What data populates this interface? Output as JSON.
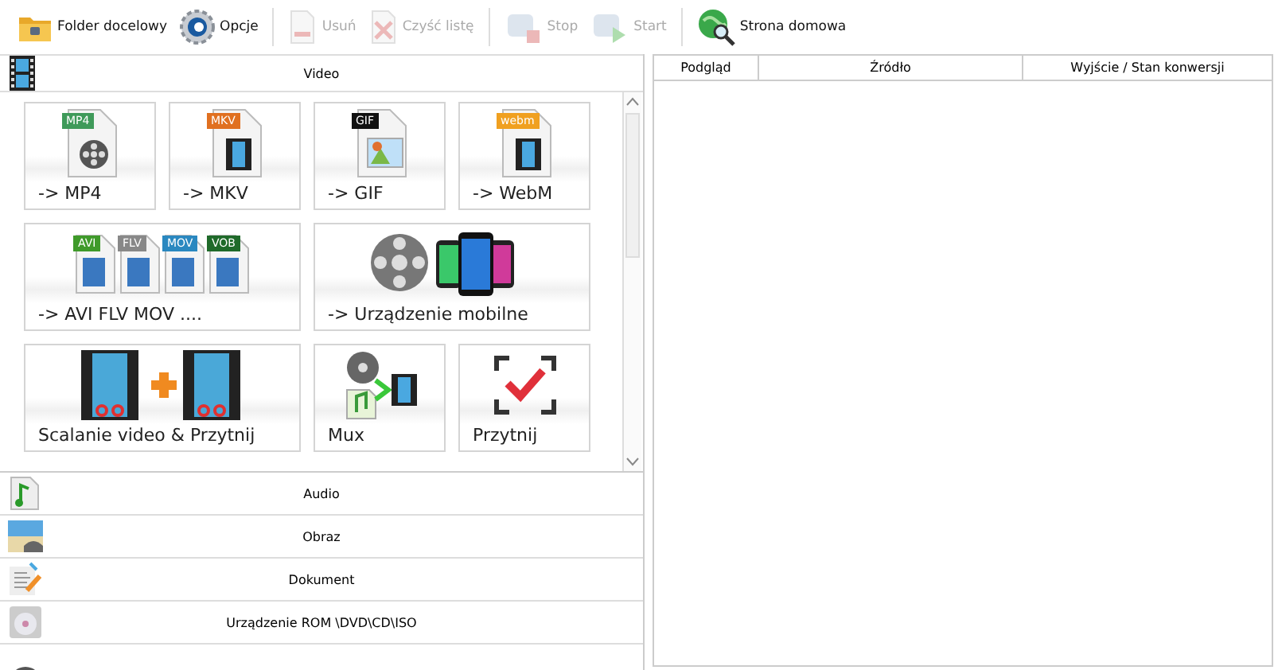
{
  "toolbar": [
    [
      {
        "label": "Folder docelowy",
        "disabled": false
      },
      {
        "label": "Opcje",
        "disabled": false
      }
    ],
    [
      {
        "label": "Usuń",
        "disabled": true
      },
      {
        "label": "Czyść listę",
        "disabled": true
      }
    ],
    [
      {
        "label": "Stop",
        "disabled": true
      },
      {
        "label": "Start",
        "disabled": true
      }
    ],
    [
      {
        "label": "Strona domowa",
        "disabled": false
      }
    ]
  ],
  "video_section": {
    "title": "Video",
    "expanded": true
  },
  "tiles": [
    {
      "label": "-> MP4",
      "badges": [
        "MP4"
      ]
    },
    {
      "label": "-> MKV",
      "badges": [
        "MKV"
      ]
    },
    {
      "label": "-> GIF",
      "badges": [
        "GIF"
      ]
    },
    {
      "label": "-> WebM",
      "badges": [
        "webm"
      ]
    },
    {
      "label": "-> AVI FLV MOV ....",
      "badges": [
        "AVI",
        "FLV",
        "MOV",
        "VOB"
      ]
    },
    {
      "label": "-> Urządzenie mobilne"
    },
    {
      "label": "Scalanie video & Przytnij"
    },
    {
      "label": "Mux"
    },
    {
      "label": "Przytnij"
    }
  ],
  "categories": [
    "Audio",
    "Obraz",
    "Dokument",
    "Urządzenie ROM \\DVD\\CD\\ISO"
  ],
  "table": {
    "columns": [
      "Podgląd",
      "Źródło",
      "Wyjście / Stan konwersji"
    ]
  }
}
